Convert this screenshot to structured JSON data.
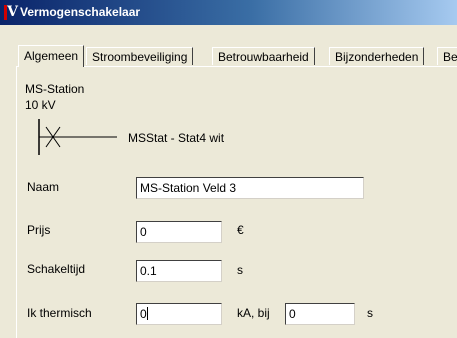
{
  "window": {
    "title": "Vermogenschakelaar"
  },
  "tabs": [
    {
      "label": "Algemeen",
      "active": true
    },
    {
      "label": "Stroombeveiliging",
      "active": false
    },
    {
      "label": "Betrouwbaarheid",
      "active": false
    },
    {
      "label": "Bijzonderheden",
      "active": false
    },
    {
      "label": "Be",
      "active": false
    }
  ],
  "header": {
    "station": "MS-Station",
    "voltage": "10 kV",
    "connection": "MSStat - Stat4 wit"
  },
  "fields": {
    "naam": {
      "label": "Naam",
      "value": "MS-Station Veld 3"
    },
    "prijs": {
      "label": "Prijs",
      "value": "0",
      "unit": "€"
    },
    "schakeltijd": {
      "label": "Schakeltijd",
      "value": "0.1",
      "unit": "s"
    },
    "ik_thermisch": {
      "label": "Ik thermisch",
      "value": "0",
      "unit": "kA, bij",
      "time_value": "0",
      "time_unit": "s"
    }
  },
  "colors": {
    "title_start": "#0a246a",
    "title_end": "#a6caf0",
    "face": "#ece9d8"
  },
  "icons": {
    "app": "app-v-icon",
    "switch": "circuit-breaker-symbol-icon"
  }
}
